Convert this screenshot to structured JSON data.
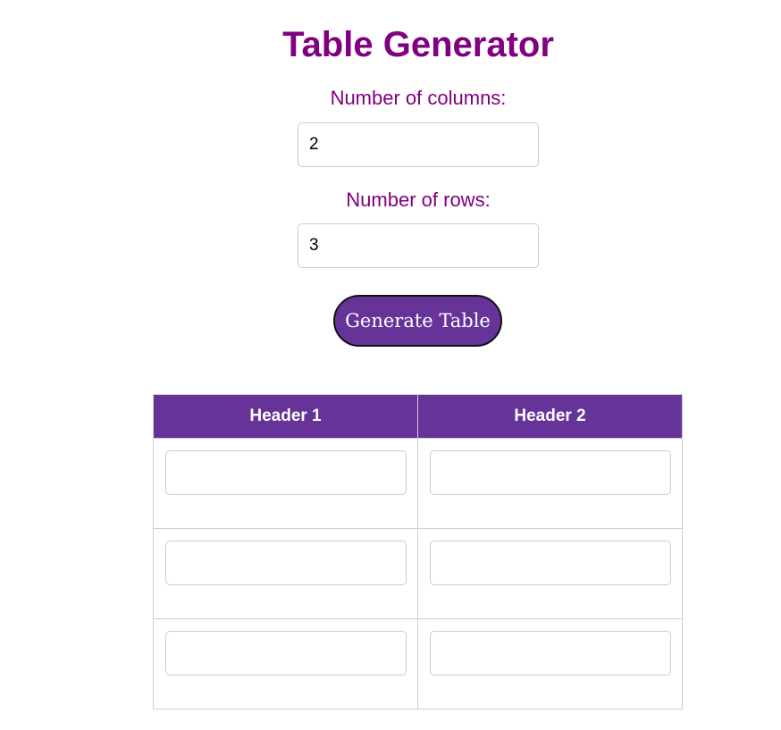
{
  "title": "Table Generator",
  "columns_field": {
    "label": "Number of columns:",
    "value": "2"
  },
  "rows_field": {
    "label": "Number of rows:",
    "value": "3"
  },
  "generate_button": {
    "label": "Generate Table"
  },
  "table": {
    "headers": [
      "Header 1",
      "Header 2"
    ],
    "rows": [
      [
        "",
        ""
      ],
      [
        "",
        ""
      ],
      [
        "",
        ""
      ]
    ]
  },
  "colors": {
    "accent": "#663399",
    "heading": "#800080"
  }
}
